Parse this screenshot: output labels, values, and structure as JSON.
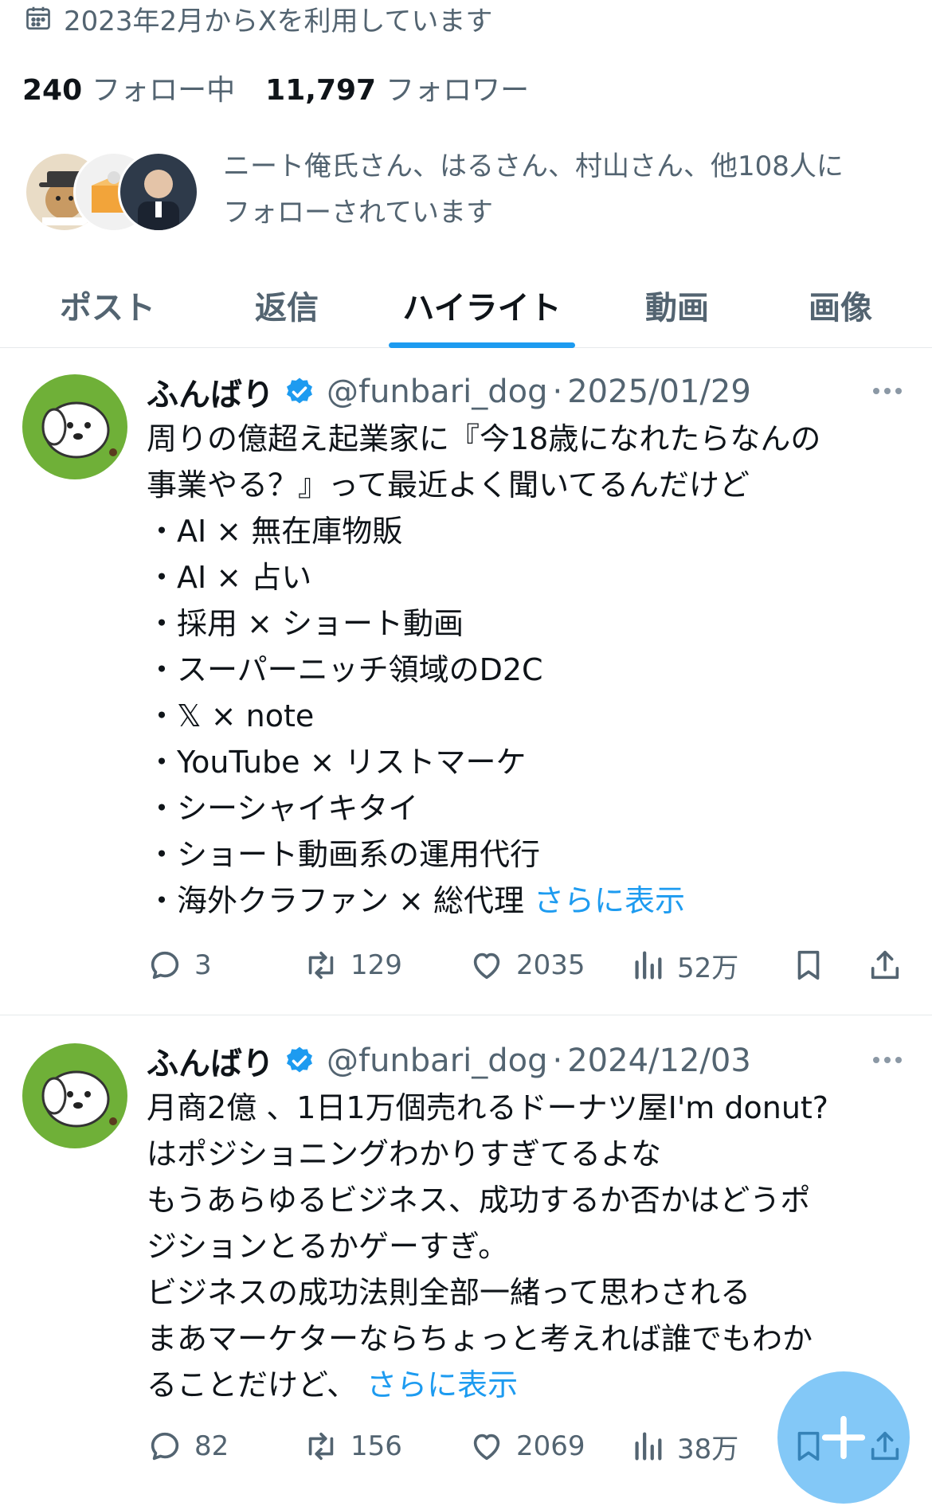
{
  "profile": {
    "joined": "2023年2月からXを利用しています",
    "following_count": "240",
    "following_label": "フォロー中",
    "followers_count": "11,797",
    "followers_label": "フォロワー",
    "followed_by_line1": "ニート俺氏さん、はるさん、村山さん、他108人に",
    "followed_by_line2": "フォローされています"
  },
  "tabs": [
    {
      "label": "ポスト"
    },
    {
      "label": "返信"
    },
    {
      "label": "ハイライト"
    },
    {
      "label": "動画"
    },
    {
      "label": "画像"
    }
  ],
  "active_tab": "ハイライト",
  "colors": {
    "accent": "#1d9bf0",
    "muted": "#536471",
    "avatar_green": "#6fb038"
  },
  "tweets": [
    {
      "name": "ふんばり",
      "handle": "@funbari_dog",
      "dot": "·",
      "date": "2025/01/29",
      "lines": [
        "周りの億超え起業家に『今18歳になれたらなんの",
        "事業やる？』って最近よく聞いてるんだけど",
        "・AI × 無在庫物販",
        "・AI × 占い",
        "・採用 × ショート動画",
        "・スーパーニッチ領域のD2C",
        "・𝕏 × note",
        "・YouTube × リストマーケ",
        "・シーシャイキタイ",
        "・ショート動画系の運用代行",
        "・海外クラファン × 総代理"
      ],
      "show_more": "さらに表示",
      "replies": "3",
      "retweets": "129",
      "likes": "2035",
      "views": "52万"
    },
    {
      "name": "ふんばり",
      "handle": "@funbari_dog",
      "dot": "·",
      "date": "2024/12/03",
      "lines": [
        "月商2億 、1日1万個売れるドーナツ屋I'm donut?",
        "はポジショニングわかりすぎてるよな",
        "もうあらゆるビジネス、成功するか否かはどうポ",
        "ジションとるかゲーすぎ。",
        "ビジネスの成功法則全部一緒って思わされる",
        "まあマーケターならちょっと考えれば誰でもわか",
        "ることだけど、"
      ],
      "show_more": "さらに表示",
      "replies": "82",
      "retweets": "156",
      "likes": "2069",
      "views": "38万"
    }
  ]
}
